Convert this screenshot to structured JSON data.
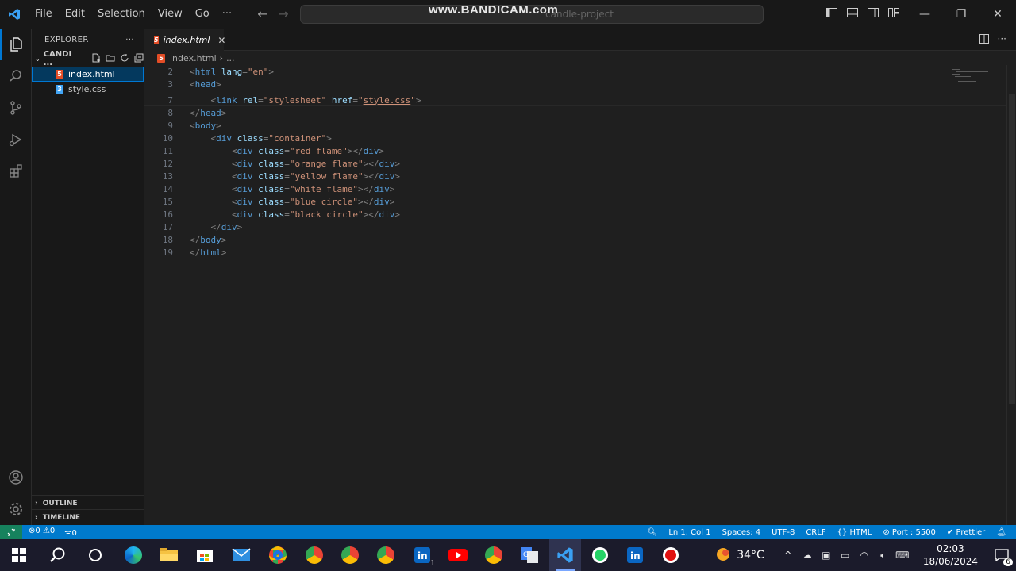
{
  "titlebar": {
    "menu": [
      "File",
      "Edit",
      "Selection",
      "View",
      "Go",
      "···"
    ],
    "command_center": "candle-project",
    "watermark": "www.BANDICAM.com"
  },
  "sidebar": {
    "header": "EXPLORER",
    "more": "···",
    "project": "CANDI ...",
    "files": [
      {
        "name": "index.html",
        "type": "html",
        "selected": true
      },
      {
        "name": "style.css",
        "type": "css",
        "selected": false
      }
    ],
    "outline": "OUTLINE",
    "timeline": "TIMELINE"
  },
  "editor": {
    "tab_label": "index.html",
    "breadcrumb_file": "index.html",
    "breadcrumb_more": "...",
    "line_numbers": [
      "2",
      "3",
      "7",
      "8",
      "9",
      "10",
      "11",
      "12",
      "13",
      "14",
      "15",
      "16",
      "17",
      "18",
      "19"
    ]
  },
  "statusbar": {
    "errors": "0",
    "warnings": "0",
    "ports": "0",
    "position": "Ln 1, Col 1",
    "spaces": "Spaces: 4",
    "encoding": "UTF-8",
    "eol": "CRLF",
    "language": "HTML",
    "port": "Port : 5500",
    "formatter": "Prettier"
  },
  "taskbar": {
    "temperature": "34°C",
    "time": "02:03",
    "date": "18/06/2024",
    "notifications": "6",
    "linkedin_badge": "1"
  },
  "colors": {
    "accent": "#0078d4",
    "statusbar": "#007acc",
    "remote": "#16825d",
    "tag": "#569cd6",
    "attribute": "#9cdcfe",
    "string": "#ce9178"
  }
}
